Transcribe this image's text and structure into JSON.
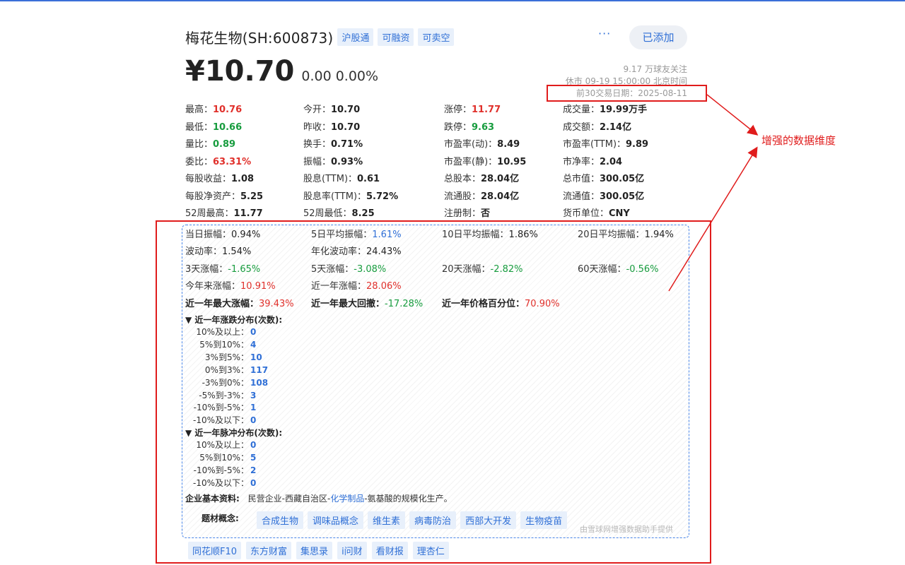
{
  "header": {
    "stock_name": "梅花生物(SH:600873)",
    "tags": [
      "沪股通",
      "可融资",
      "可卖空"
    ],
    "more": "···",
    "added_button": "已添加"
  },
  "price": {
    "value": "¥10.70",
    "change": "0.00 0.00%"
  },
  "meta": {
    "followers": "9.17 万球友关注",
    "status": "休市 09-19 15:00:00 北京时间",
    "trade_date": "前30交易日期：2025-08-11"
  },
  "quotes": [
    [
      {
        "label": "最高：",
        "value": "10.76",
        "color": "red"
      },
      {
        "label": "今开：",
        "value": "10.70",
        "color": "dark"
      },
      {
        "label": "涨停：",
        "value": "11.77",
        "color": "red"
      },
      {
        "label": "成交量：",
        "value": "19.99万手",
        "color": "dark"
      }
    ],
    [
      {
        "label": "最低：",
        "value": "10.66",
        "color": "green"
      },
      {
        "label": "昨收：",
        "value": "10.70",
        "color": "dark"
      },
      {
        "label": "跌停：",
        "value": "9.63",
        "color": "green"
      },
      {
        "label": "成交额：",
        "value": "2.14亿",
        "color": "dark"
      }
    ],
    [
      {
        "label": "量比：",
        "value": "0.89",
        "color": "green"
      },
      {
        "label": "换手：",
        "value": "0.71%",
        "color": "dark"
      },
      {
        "label": "市盈率(动)：",
        "value": "8.49",
        "color": "dark"
      },
      {
        "label": "市盈率(TTM)：",
        "value": "9.89",
        "color": "dark"
      }
    ],
    [
      {
        "label": "委比：",
        "value": "63.31%",
        "color": "red"
      },
      {
        "label": "振幅：",
        "value": "0.93%",
        "color": "dark"
      },
      {
        "label": "市盈率(静)：",
        "value": "10.95",
        "color": "dark"
      },
      {
        "label": "市净率：",
        "value": "2.04",
        "color": "dark"
      }
    ],
    [
      {
        "label": "每股收益：",
        "value": "1.08",
        "color": "dark"
      },
      {
        "label": "股息(TTM)：",
        "value": "0.61",
        "color": "dark"
      },
      {
        "label": "总股本：",
        "value": "28.04亿",
        "color": "dark"
      },
      {
        "label": "总市值：",
        "value": "300.05亿",
        "color": "dark"
      }
    ],
    [
      {
        "label": "每股净资产：",
        "value": "5.25",
        "color": "dark"
      },
      {
        "label": "股息率(TTM)：",
        "value": "5.72%",
        "color": "dark"
      },
      {
        "label": "流通股：",
        "value": "28.04亿",
        "color": "dark"
      },
      {
        "label": "流通值：",
        "value": "300.05亿",
        "color": "dark"
      }
    ],
    [
      {
        "label": "52周最高：",
        "value": "11.77",
        "color": "dark"
      },
      {
        "label": "52周最低：",
        "value": "8.25",
        "color": "dark"
      },
      {
        "label": "注册制：",
        "value": "否",
        "color": "dark"
      },
      {
        "label": "货币单位：",
        "value": "CNY",
        "color": "dark"
      }
    ]
  ],
  "extended": {
    "rows": [
      [
        {
          "label": "当日振幅：",
          "value": "0.94%",
          "color": "dark"
        },
        {
          "label": "5日平均振幅：",
          "value": "1.61%",
          "color": "blue"
        },
        {
          "label": "10日平均振幅：",
          "value": "1.86%",
          "color": "dark"
        },
        {
          "label": "20日平均振幅：",
          "value": "1.94%",
          "color": "dark"
        }
      ],
      [
        {
          "label": "波动率：",
          "value": "1.54%",
          "color": "dark"
        },
        {
          "label": "年化波动率：",
          "value": "24.43%",
          "color": "dark"
        }
      ],
      [
        {
          "label": "3天涨幅：",
          "value": "-1.65%",
          "color": "green"
        },
        {
          "label": "5天涨幅：",
          "value": "-3.08%",
          "color": "green"
        },
        {
          "label": "20天涨幅：",
          "value": "-2.82%",
          "color": "green"
        },
        {
          "label": "60天涨幅：",
          "value": "-0.56%",
          "color": "green"
        }
      ],
      [
        {
          "label": "今年来涨幅：",
          "value": "10.91%",
          "color": "red"
        },
        {
          "label": "近一年涨幅：",
          "value": "28.06%",
          "color": "red"
        }
      ],
      [
        {
          "label": "近一年最大涨幅：",
          "value": "39.43%",
          "color": "red"
        },
        {
          "label": "近一年最大回撤：",
          "value": "-17.28%",
          "color": "green"
        },
        {
          "label": "近一年价格百分位：",
          "value": "70.90%",
          "color": "red"
        }
      ]
    ],
    "dist1": {
      "title": "▼ 近一年涨跌分布(次数):",
      "items": [
        {
          "label": "10%及以上：",
          "value": "0"
        },
        {
          "label": "5%到10%：",
          "value": "4"
        },
        {
          "label": "3%到5%：",
          "value": "10"
        },
        {
          "label": "0%到3%：",
          "value": "117"
        },
        {
          "label": "-3%到0%：",
          "value": "108"
        },
        {
          "label": "-5%到-3%：",
          "value": "3"
        },
        {
          "label": "-10%到-5%：",
          "value": "1"
        },
        {
          "label": "-10%及以下：",
          "value": "0"
        }
      ]
    },
    "dist2": {
      "title": "▼ 近一年脉冲分布(次数):",
      "items": [
        {
          "label": "10%及以上：",
          "value": "0"
        },
        {
          "label": "5%到10%：",
          "value": "5"
        },
        {
          "label": "-10%到-5%：",
          "value": "2"
        },
        {
          "label": "-10%及以下：",
          "value": "0"
        }
      ]
    },
    "profile_label": "企业基本资料:",
    "profile_part1": "民营企业-西藏自治区-",
    "profile_link": "化学制品",
    "profile_part2": "-氨基酸的规模化生产。",
    "concept_label": "题材概念:",
    "concepts": [
      "合成生物",
      "调味品概念",
      "维生素",
      "病毒防治",
      "西部大开发",
      "生物疫苗"
    ],
    "provider": "由雪球网增强数据助手提供"
  },
  "links": [
    "同花顺F10",
    "东方财富",
    "集思录",
    "i问财",
    "看财报",
    "理杏仁"
  ],
  "annotation": {
    "text": "增强的数据维度",
    "color": "#e01c1c"
  },
  "colors": {
    "red": "#e0302b",
    "green": "#179c3e",
    "blue": "#2f6fd6",
    "accent": "#2f6fd6"
  }
}
